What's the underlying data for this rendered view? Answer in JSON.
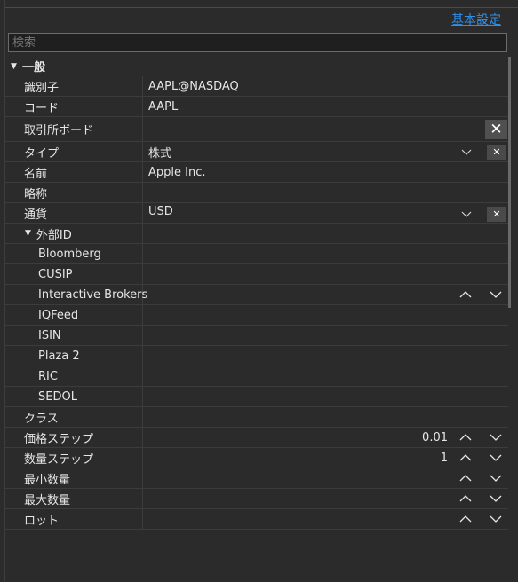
{
  "header": {
    "basic_settings_link": "基本設定"
  },
  "search": {
    "placeholder": "検索"
  },
  "section": {
    "label": "一般"
  },
  "rows": {
    "identifier": {
      "label": "識別子",
      "value": "AAPL@NASDAQ"
    },
    "code": {
      "label": "コード",
      "value": "AAPL"
    },
    "board": {
      "label": "取引所ボード",
      "value": ""
    },
    "type": {
      "label": "タイプ",
      "value": "株式"
    },
    "name": {
      "label": "名前",
      "value": "Apple Inc."
    },
    "short_name": {
      "label": "略称",
      "value": ""
    },
    "currency": {
      "label": "通貨",
      "value": "USD"
    },
    "external_id": {
      "label": "外部ID"
    },
    "bloomberg": {
      "label": "Bloomberg"
    },
    "cusip": {
      "label": "CUSIP"
    },
    "ib": {
      "label": "Interactive Brokers"
    },
    "iqfeed": {
      "label": "IQFeed"
    },
    "isin": {
      "label": "ISIN"
    },
    "plaza2": {
      "label": "Plaza 2"
    },
    "ric": {
      "label": "RIC"
    },
    "sedol": {
      "label": "SEDOL"
    },
    "class": {
      "label": "クラス"
    },
    "price_step": {
      "label": "価格ステップ",
      "value": "0.01"
    },
    "volume_step": {
      "label": "数量ステップ",
      "value": "1"
    },
    "min_volume": {
      "label": "最小数量",
      "value": ""
    },
    "max_volume": {
      "label": "最大数量",
      "value": ""
    },
    "lot": {
      "label": "ロット",
      "value": ""
    }
  },
  "icons": {
    "clear": "close-icon",
    "dropdown": "chevron-down-icon",
    "increment": "chevron-up-icon",
    "decrement": "chevron-down-icon",
    "section_caret": "caret-down-icon"
  },
  "colors": {
    "link": "#2f8fe8",
    "background": "#2b2b2b"
  }
}
